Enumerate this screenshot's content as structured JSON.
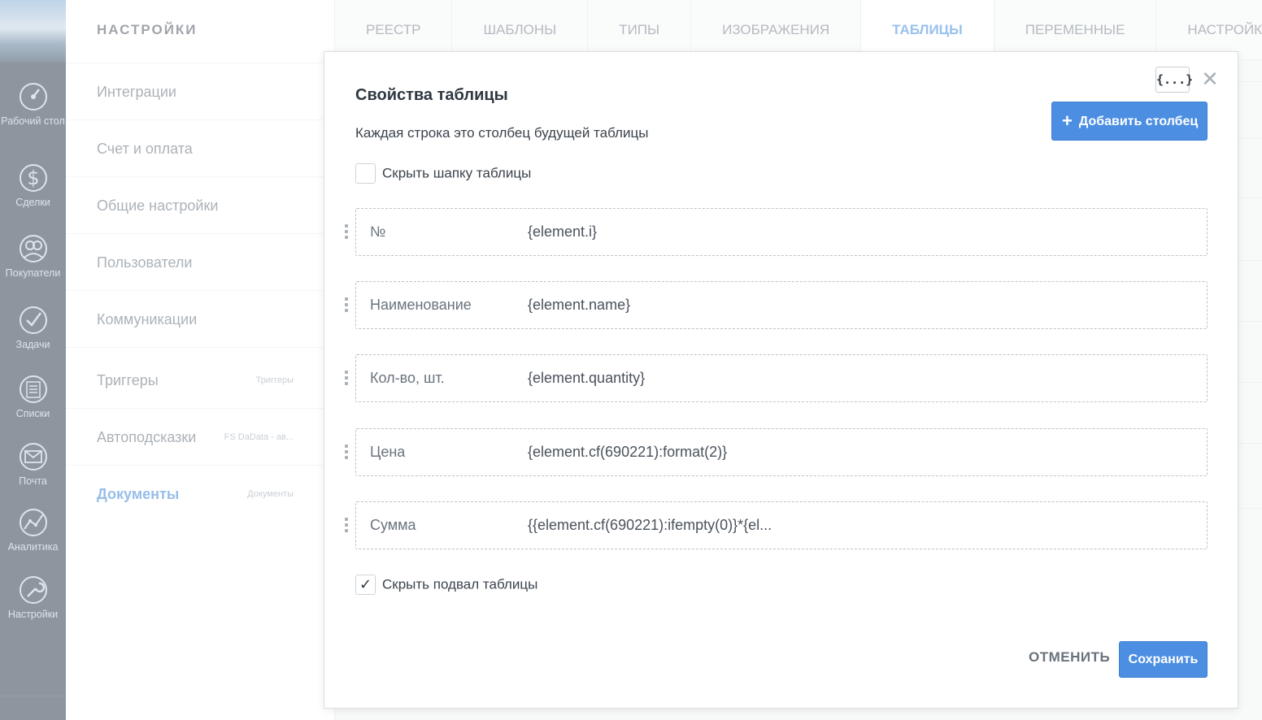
{
  "sidebar": {
    "items": [
      {
        "label": "Рабочий стол",
        "icon": "dashboard-icon"
      },
      {
        "label": "Сделки",
        "icon": "dollar-icon"
      },
      {
        "label": "Покупатели",
        "icon": "customers-icon"
      },
      {
        "label": "Задачи",
        "icon": "check-icon"
      },
      {
        "label": "Списки",
        "icon": "list-icon"
      },
      {
        "label": "Почта",
        "icon": "mail-icon"
      },
      {
        "label": "Аналитика",
        "icon": "analytics-icon"
      },
      {
        "label": "Настройки",
        "icon": "wrench-icon"
      }
    ]
  },
  "settings": {
    "title": "НАСТРОЙКИ",
    "menu": [
      {
        "label": "Интеграции",
        "sub": ""
      },
      {
        "label": "Счет и оплата",
        "sub": ""
      },
      {
        "label": "Общие настройки",
        "sub": ""
      },
      {
        "label": "Пользователи",
        "sub": ""
      },
      {
        "label": "Коммуникации",
        "sub": ""
      },
      {
        "label": "Триггеры",
        "sub": "Триггеры"
      },
      {
        "label": "Автоподсказки",
        "sub": "FS DaData - ав..."
      },
      {
        "label": "Документы",
        "sub": "Документы",
        "active": true
      }
    ]
  },
  "tabs": [
    {
      "label": "РЕЕСТР"
    },
    {
      "label": "ШАБЛОНЫ"
    },
    {
      "label": "ТИПЫ"
    },
    {
      "label": "ИЗОБРАЖЕНИЯ"
    },
    {
      "label": "ТАБЛИЦЫ",
      "active": true
    },
    {
      "label": "ПЕРЕМЕННЫЕ"
    },
    {
      "label": "НАСТРОЙКИ"
    }
  ],
  "modal": {
    "title": "Свойства таблицы",
    "subtitle": "Каждая строка это столбец будущей таблицы",
    "vars_button": "{...}",
    "close_symbol": "✕",
    "add_column_label": "Добавить столбец",
    "hide_header": {
      "label": "Скрыть шапку таблицы",
      "checked": false
    },
    "columns": [
      {
        "name": "№",
        "value": "{element.i}"
      },
      {
        "name": "Наименование",
        "value": "{element.name}"
      },
      {
        "name": "Кол-во, шт.",
        "value": "{element.quantity}"
      },
      {
        "name": "Цена",
        "value": "{element.cf(690221):format(2)}"
      },
      {
        "name": "Сумма",
        "value": "{{element.cf(690221):ifempty(0)}*{el..."
      }
    ],
    "hide_footer": {
      "label": "Скрыть подвал таблицы",
      "checked": true
    },
    "cancel_label": "ОТМЕНИТЬ",
    "save_label": "Сохранить"
  },
  "colors": {
    "accent": "#4c8fe2",
    "sidebar_bg": "#3b4a5a",
    "active_tab": "#4f95e0"
  }
}
